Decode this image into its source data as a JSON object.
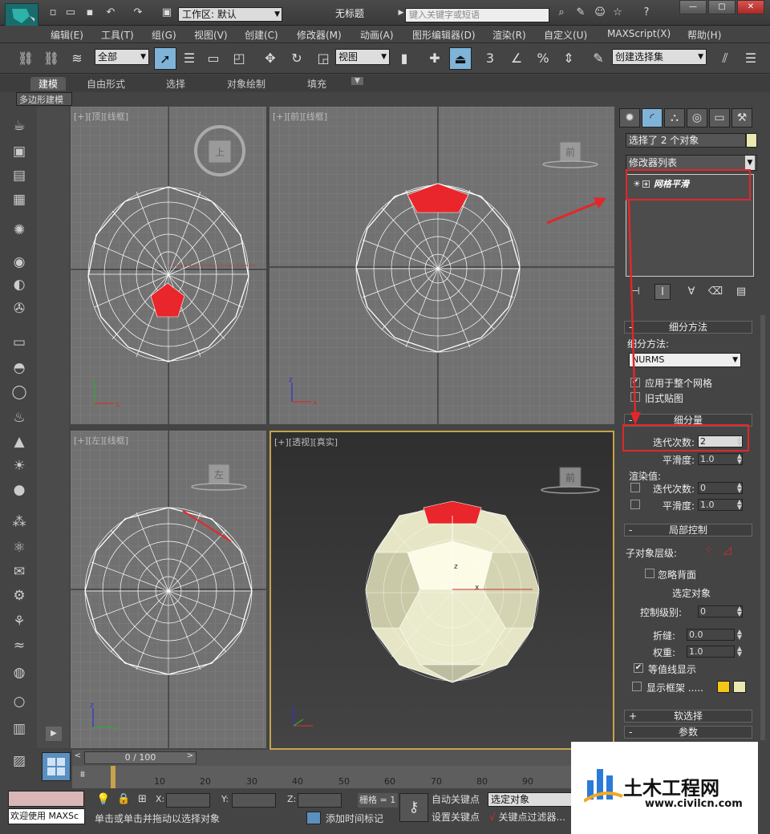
{
  "title_bar": {
    "workspace_label": "工作区: 默认",
    "document_title": "无标题",
    "search_placeholder": "键入关键字或短语"
  },
  "menu": {
    "items": [
      "编辑(E)",
      "工具(T)",
      "组(G)",
      "视图(V)",
      "创建(C)",
      "修改器(M)",
      "动画(A)",
      "图形编辑器(D)",
      "渲染(R)",
      "自定义(U)",
      "MAXScript(X)",
      "帮助(H)"
    ]
  },
  "toolbar": {
    "filter_select": "全部",
    "coord_select": "视图",
    "named_selection": "创建选择集",
    "snap_3": "3"
  },
  "ribbon": {
    "tabs": [
      "建模",
      "自由形式",
      "选择",
      "对象绘制",
      "填充"
    ],
    "active_tab": "建模",
    "sub_tab": "多边形建模"
  },
  "viewports": {
    "top": {
      "plus": "[+]",
      "view": "[顶]",
      "shade": "[线框]",
      "cube_label": "上"
    },
    "front": {
      "plus": "[+]",
      "view": "[前]",
      "shade": "[线框]",
      "cube_label": "前"
    },
    "left": {
      "plus": "[+]",
      "view": "[左]",
      "shade": "[线框]",
      "cube_label": "左"
    },
    "persp": {
      "plus": "[+]",
      "view": "[透视]",
      "shade": "[真实]",
      "cube_label": "前"
    },
    "axis_x": "x",
    "axis_y": "y",
    "axis_z": "z"
  },
  "command_panel": {
    "selected_text": "选择了 2 个对象",
    "modifier_list": "修改器列表",
    "stack_item": "网格平滑",
    "subdivision_method": {
      "header": "细分方法",
      "method_label": "细分方法:",
      "method_value": "NURMS",
      "apply_whole": "应用于整个网格",
      "old_mapping": "旧式贴图"
    },
    "subdivision_amount": {
      "header": "细分量",
      "iterations_label": "迭代次数:",
      "iterations_value": "2",
      "smoothness_label": "平滑度:",
      "smoothness_value": "1.0",
      "render_label": "渲染值:",
      "render_iterations_label": "迭代次数:",
      "render_iterations_value": "0",
      "render_smoothness_label": "平滑度:",
      "render_smoothness_value": "1.0"
    },
    "local_control": {
      "header": "局部控制",
      "subobject_level": "子对象层级:",
      "ignore_backfacing": "忽略背面",
      "selected_object": "选定对象",
      "control_level_label": "控制级别:",
      "control_level_value": "0",
      "crease_label": "折缝:",
      "crease_value": "0.0",
      "weight_label": "权重:",
      "weight_value": "1.0",
      "isoline_display": "等值线显示",
      "show_cage": "显示框架 ....."
    },
    "soft_selection": "软选择",
    "parameters": "参数"
  },
  "timeline": {
    "slider": "0 / 100",
    "ticks": [
      "10",
      "20",
      "30",
      "40",
      "50",
      "60",
      "70",
      "80",
      "90"
    ]
  },
  "status": {
    "welcome": "欢迎使用 MAXSc",
    "prompt": "单击或单击并拖动以选择对象",
    "x_label": "X:",
    "y_label": "Y:",
    "z_label": "Z:",
    "grid": "栅格 = 1",
    "auto_key": "自动关键点",
    "set_key": "设置关键点",
    "selected_object": "选定对象",
    "key_filter": "关键点过滤器...",
    "add_time_tag": "添加时间标记"
  },
  "watermark": {
    "text": "土木工程网",
    "url": "www.civilcn.com"
  },
  "colors": {
    "selection_red": "#e8262b",
    "highlight_blue": "#7fb3d8",
    "persp_border": "#c8a24b"
  }
}
